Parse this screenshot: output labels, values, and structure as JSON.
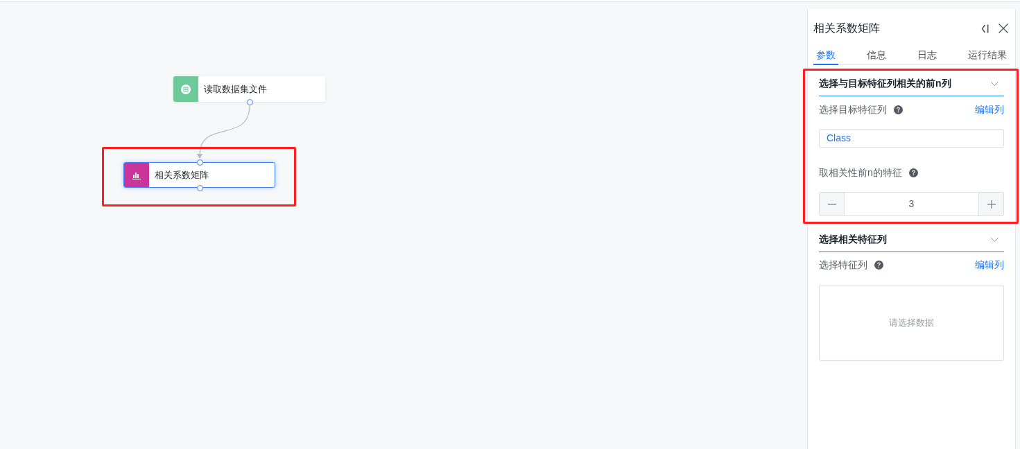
{
  "canvas": {
    "nodes": [
      {
        "kind": "dataset",
        "label": "读取数据集文件",
        "color": "#6ccb98",
        "selected": false
      },
      {
        "kind": "chart",
        "label": "相关系数矩阵",
        "color": "#c9359a",
        "selected": true
      }
    ]
  },
  "panel": {
    "title": "相关系数矩阵",
    "tabs": [
      {
        "label": "参数",
        "selected": true
      },
      {
        "label": "信息",
        "selected": false
      },
      {
        "label": "日志",
        "selected": false
      },
      {
        "label": "运行结果",
        "selected": false
      }
    ],
    "sections": [
      {
        "title": "选择与目标特征列相关的前n列",
        "expanded": true,
        "fields": [
          {
            "kind": "column_select",
            "label": "选择目标特征列",
            "action": "编辑列",
            "value": "Class"
          },
          {
            "kind": "stepper",
            "label": "取相关性前n的特征",
            "value": "3"
          }
        ]
      },
      {
        "title": "选择相关特征列",
        "expanded": true,
        "fields": [
          {
            "kind": "column_list",
            "label": "选择特征列",
            "action": "编辑列",
            "placeholder": "请选择数据"
          }
        ]
      }
    ]
  }
}
